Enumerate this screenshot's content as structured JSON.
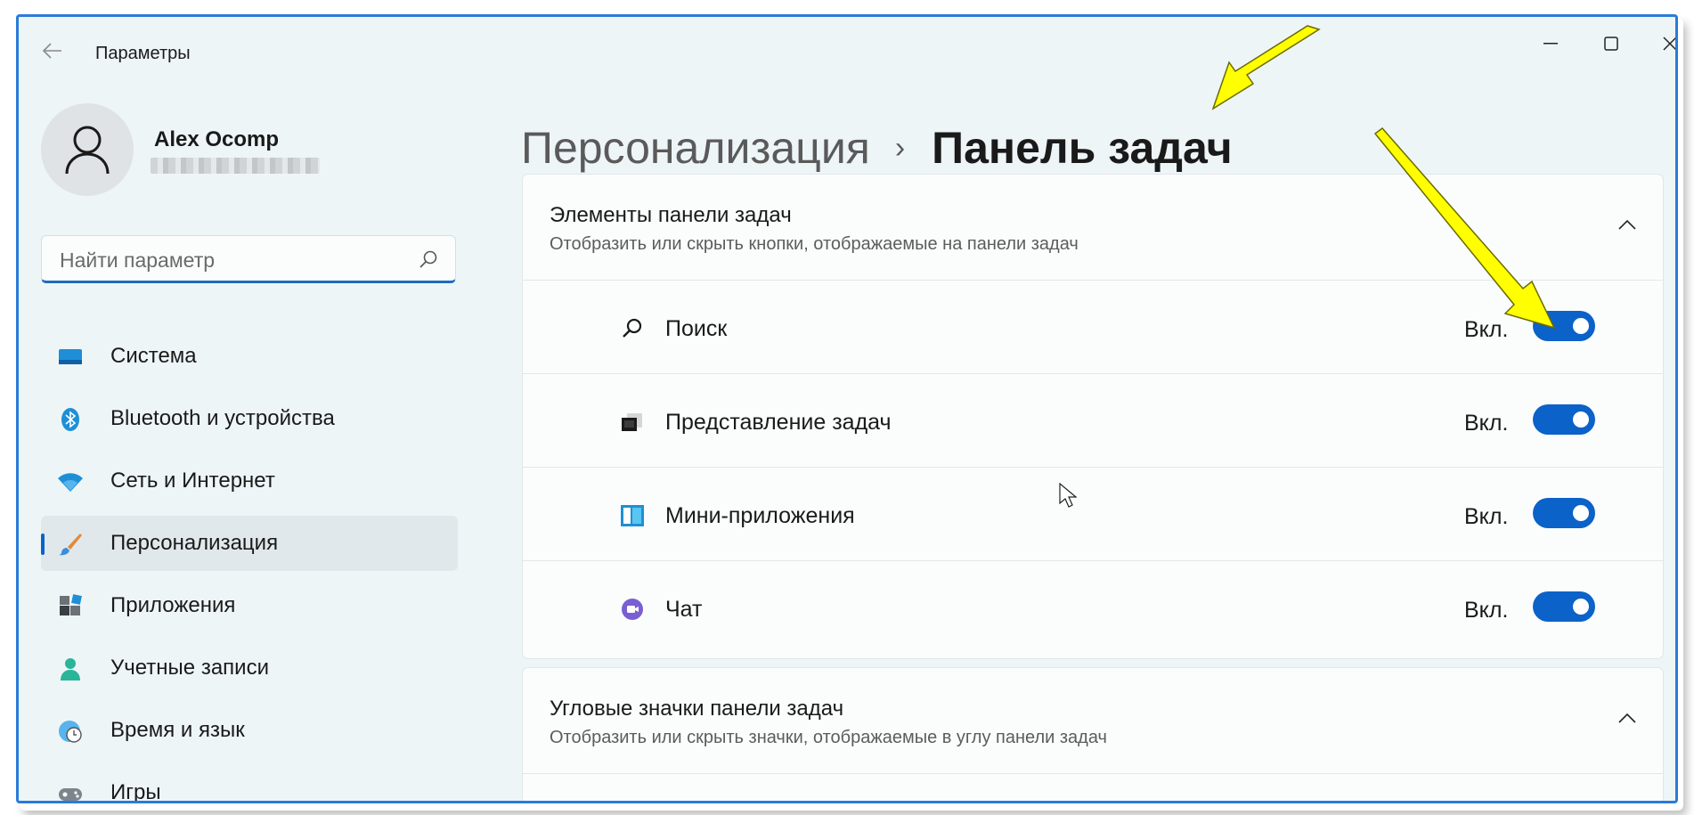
{
  "window": {
    "title": "Параметры",
    "controls": {
      "minimize": "–",
      "maximize": "☐",
      "close": "✕"
    }
  },
  "user": {
    "name": "Alex Ocomp"
  },
  "search": {
    "placeholder": "Найти параметр"
  },
  "sidebar": {
    "items": [
      {
        "label": "Система",
        "icon": "system-icon"
      },
      {
        "label": "Bluetooth и устройства",
        "icon": "bluetooth-icon"
      },
      {
        "label": "Сеть и Интернет",
        "icon": "wifi-icon"
      },
      {
        "label": "Персонализация",
        "icon": "brush-icon",
        "active": true
      },
      {
        "label": "Приложения",
        "icon": "apps-icon"
      },
      {
        "label": "Учетные записи",
        "icon": "account-icon"
      },
      {
        "label": "Время и язык",
        "icon": "clock-globe-icon"
      },
      {
        "label": "Игры",
        "icon": "gamepad-icon"
      }
    ]
  },
  "breadcrumb": {
    "parent": "Персонализация",
    "separator": "›",
    "current": "Панель задач"
  },
  "sections": [
    {
      "title": "Элементы панели задач",
      "subtitle": "Отобразить или скрыть кнопки, отображаемые на панели задач",
      "expanded": true,
      "rows": [
        {
          "label": "Поиск",
          "state": "Вкл.",
          "on": true,
          "icon": "search-icon"
        },
        {
          "label": "Представление задач",
          "state": "Вкл.",
          "on": true,
          "icon": "task-view-icon"
        },
        {
          "label": "Мини-приложения",
          "state": "Вкл.",
          "on": true,
          "icon": "widgets-icon"
        },
        {
          "label": "Чат",
          "state": "Вкл.",
          "on": true,
          "icon": "chat-icon"
        }
      ]
    },
    {
      "title": "Угловые значки панели задач",
      "subtitle": "Отобразить или скрыть значки, отображаемые в углу панели задач",
      "expanded": true
    }
  ],
  "colors": {
    "accent": "#0b62c9",
    "annotation_arrow": "#ffff00",
    "frame": "#2b7bd9"
  }
}
